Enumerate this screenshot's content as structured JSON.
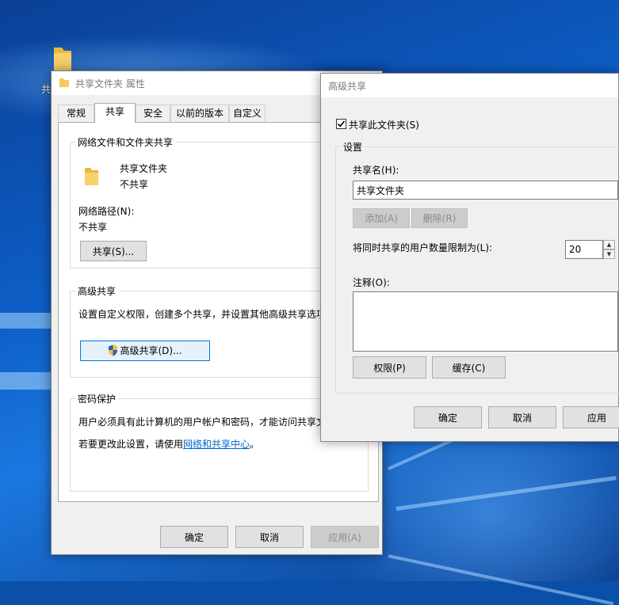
{
  "desktop": {
    "icon_label": "共"
  },
  "properties": {
    "title": "共享文件夹 属性",
    "tabs": [
      "常规",
      "共享",
      "安全",
      "以前的版本",
      "自定义"
    ],
    "network_group_label": "网络文件和文件夹共享",
    "folder_name": "共享文件夹",
    "share_status": "不共享",
    "network_path_label": "网络路径(N):",
    "network_path_value": "不共享",
    "share_button": "共享(S)...",
    "advanced_group_label": "高级共享",
    "advanced_desc": "设置自定义权限，创建多个共享，并设置其他高级共享选项",
    "advanced_button": "高级共享(D)...",
    "password_group_label": "密码保护",
    "password_desc": "用户必须具有此计算机的用户帐户和密码，才能访问共享文",
    "change_prefix": "若要更改此设置，请使用",
    "change_link": "网络和共享中心",
    "change_suffix": "。",
    "ok_button": "确定",
    "cancel_button": "取消",
    "apply_button": "应用(A)"
  },
  "advanced": {
    "title": "高级共享",
    "share_checkbox_label": "共享此文件夹(S)",
    "share_checked": true,
    "settings_label": "设置",
    "share_name_label": "共享名(H):",
    "share_name_value": "共享文件夹",
    "add_button": "添加(A)",
    "remove_button": "删除(R)",
    "user_limit_label": "将同时共享的用户数量限制为(L):",
    "user_limit_value": "20",
    "comment_label": "注释(O):",
    "comment_value": "",
    "permissions_button": "权限(P)",
    "cache_button": "缓存(C)",
    "ok_button": "确定",
    "cancel_button": "取消",
    "apply_button": "应用"
  },
  "colors": {
    "accent": "#0078d7",
    "desktop": "#0d5fc7",
    "folder": "#f4c95d"
  }
}
